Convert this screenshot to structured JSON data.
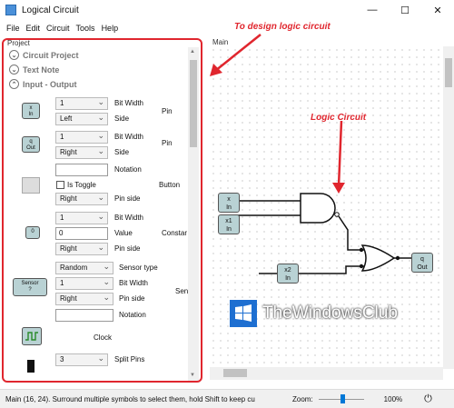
{
  "window": {
    "title": "Logical Circuit",
    "minimize": "—",
    "maximize": "☐",
    "close": "✕"
  },
  "menu": [
    "File",
    "Edit",
    "Circuit",
    "Tools",
    "Help"
  ],
  "panel": {
    "label": "Project",
    "sections": [
      "Circuit Project",
      "Text Note",
      "Input - Output"
    ]
  },
  "props": {
    "pin1": {
      "sym": "x\nIn",
      "bitwidth": "1",
      "side": "Left",
      "bw_label": "Bit Width",
      "side_label": "Side",
      "name": "Pin"
    },
    "pin2": {
      "sym": "q\nOut",
      "bitwidth": "1",
      "side": "Right",
      "bw_label": "Bit Width",
      "side_label": "Side",
      "name": "Pin"
    },
    "button": {
      "notation_label": "Notation",
      "toggle_label": "Is Toggle",
      "pinside": "Right",
      "pinside_label": "Pin side",
      "name": "Button"
    },
    "constant": {
      "sym": "0",
      "bitwidth": "1",
      "value": "0",
      "pinside": "Right",
      "bw_label": "Bit Width",
      "value_label": "Value",
      "pinside_label": "Pin side",
      "name": "Constar"
    },
    "sensor": {
      "sym": "Sensor\n?",
      "type": "Random",
      "bitwidth": "1",
      "pinside": "Right",
      "type_label": "Sensor type",
      "bw_label": "Bit Width",
      "pinside_label": "Pin side",
      "notation_label": "Notation",
      "name": "Sen"
    },
    "clock": {
      "name": "Clock"
    },
    "splitter": {
      "pins": "3",
      "pins_label": "Split Pins"
    }
  },
  "main": {
    "label": "Main",
    "inputs": [
      {
        "name": "x",
        "kind": "In"
      },
      {
        "name": "x1",
        "kind": "In"
      },
      {
        "name": "x2",
        "kind": "In"
      }
    ],
    "output": {
      "name": "q",
      "kind": "Out"
    }
  },
  "annotations": {
    "design": "To design logic circuit",
    "circuit": "Logic Circuit"
  },
  "watermark": "TheWindowsClub",
  "status": {
    "text": "Main (16, 24). Surround multiple symbols to select them, hold Shift to keep cu",
    "zoom_label": "Zoom:",
    "zoom": "100%"
  },
  "colors": {
    "accent": "#e0262e",
    "symbol": "#b9d2d4"
  }
}
